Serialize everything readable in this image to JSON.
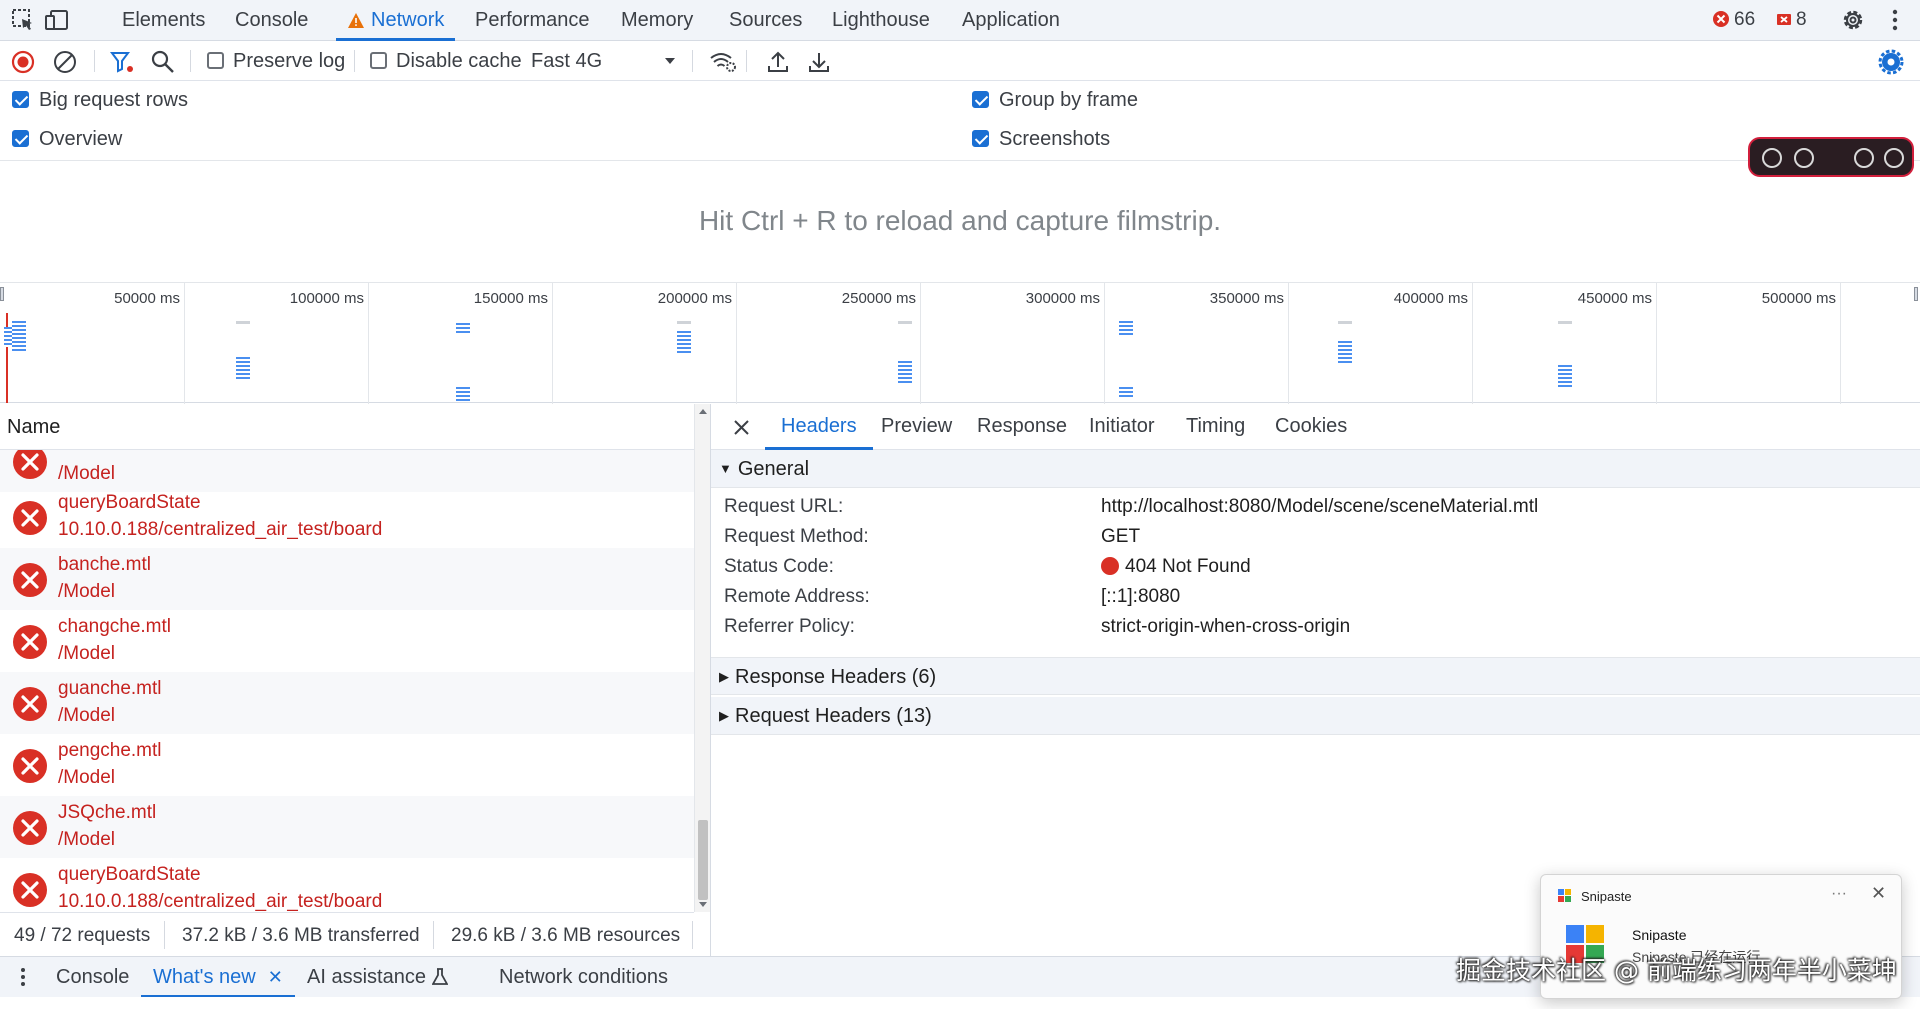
{
  "tabs": [
    {
      "label": "Elements"
    },
    {
      "label": "Console"
    },
    {
      "label": "Network",
      "warning": true
    },
    {
      "label": "Performance"
    },
    {
      "label": "Memory"
    },
    {
      "label": "Sources"
    },
    {
      "label": "Lighthouse"
    },
    {
      "label": "Application"
    }
  ],
  "badges": {
    "errors": "66",
    "issues": "8"
  },
  "toolbar": {
    "preserve_log": "Preserve log",
    "disable_cache": "Disable cache",
    "throttling": "Fast 4G"
  },
  "settings": {
    "big_request_rows": "Big request rows",
    "overview": "Overview",
    "group_by_frame": "Group by frame",
    "screenshots": "Screenshots"
  },
  "filmstrip_message": "Hit Ctrl + R to reload and capture filmstrip.",
  "timeline": {
    "ticks": [
      "50000 ms",
      "100000 ms",
      "150000 ms",
      "200000 ms",
      "250000 ms",
      "300000 ms",
      "350000 ms",
      "400000 ms",
      "450000 ms",
      "500000 ms"
    ]
  },
  "request_list": {
    "header": "Name",
    "rows": [
      {
        "name": "",
        "path": "/Model"
      },
      {
        "name": "queryBoardState",
        "path": "10.10.0.188/centralized_air_test/board"
      },
      {
        "name": "banche.mtl",
        "path": "/Model"
      },
      {
        "name": "changche.mtl",
        "path": "/Model"
      },
      {
        "name": "guanche.mtl",
        "path": "/Model"
      },
      {
        "name": "pengche.mtl",
        "path": "/Model"
      },
      {
        "name": "JSQche.mtl",
        "path": "/Model"
      },
      {
        "name": "queryBoardState",
        "path": "10.10.0.188/centralized_air_test/board"
      }
    ],
    "summary": {
      "requests": "49 / 72 requests",
      "transferred": "37.2 kB / 3.6 MB transferred",
      "resources": "29.6 kB / 3.6 MB resources"
    }
  },
  "detail": {
    "tabs": [
      "Headers",
      "Preview",
      "Response",
      "Initiator",
      "Timing",
      "Cookies"
    ],
    "general": {
      "title": "General",
      "fields": [
        {
          "key": "Request URL:",
          "value": "http://localhost:8080/Model/scene/sceneMaterial.mtl"
        },
        {
          "key": "Request Method:",
          "value": "GET"
        },
        {
          "key": "Status Code:",
          "value": "404 Not Found"
        },
        {
          "key": "Remote Address:",
          "value": "[::1]:8080"
        },
        {
          "key": "Referrer Policy:",
          "value": "strict-origin-when-cross-origin"
        }
      ]
    },
    "response_headers": "Response Headers (6)",
    "request_headers": "Request Headers (13)"
  },
  "drawer": {
    "console": "Console",
    "whats_new": "What's new",
    "ai_assistance": "AI assistance",
    "network_conditions": "Network conditions"
  },
  "toast": {
    "app": "Snipaste",
    "title": "Snipaste",
    "body": "Snipaste 已经在运行"
  },
  "watermark": "掘金技术社区 @ 前端练习两年半小菜坤",
  "colors": {
    "accent": "#1a6fd3",
    "error": "#c5221f",
    "status_red": "#d93025"
  }
}
